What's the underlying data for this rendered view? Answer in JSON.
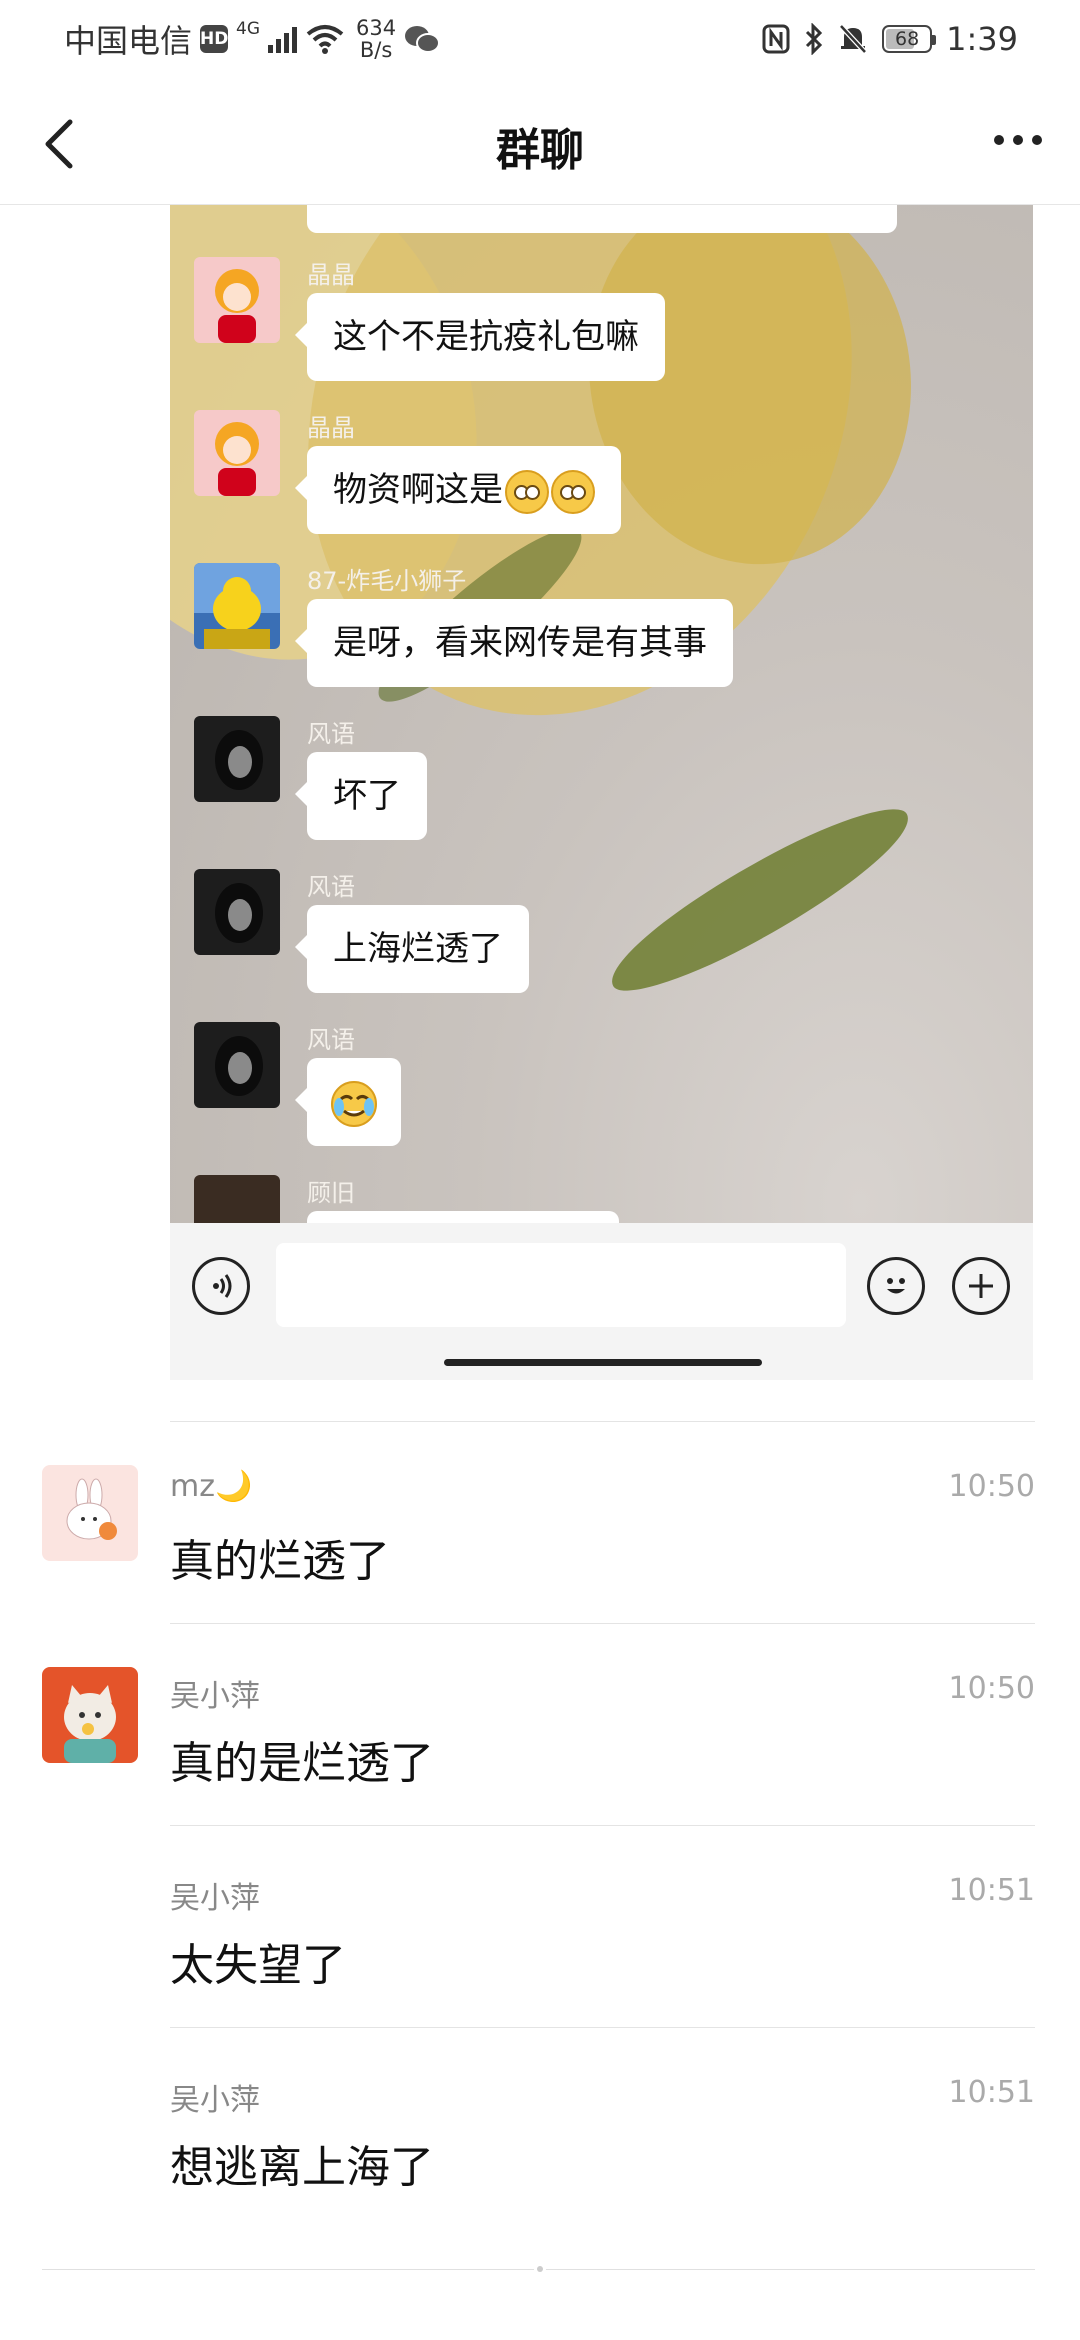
{
  "status_bar": {
    "carrier": "中国电信",
    "hd": "HD",
    "network": "4G",
    "speed_value": "634",
    "speed_unit": "B/s",
    "battery": "68",
    "time": "1:39"
  },
  "header": {
    "title": "群聊"
  },
  "embedded_chat": {
    "messages": [
      {
        "sender": "晶晶",
        "text": "这个不是抗疫礼包嘛",
        "avatar": "tiger-costume-girl"
      },
      {
        "sender": "晶晶",
        "text": "物资啊这是",
        "emoji": "flushed-face",
        "avatar": "tiger-costume-girl"
      },
      {
        "sender": "87-炸毛小狮子",
        "text": "是呀，看来网传是有其事",
        "avatar": "yellow-duck-statue"
      },
      {
        "sender": "风语",
        "text": "坏了",
        "avatar": "dark-hair-girl"
      },
      {
        "sender": "风语",
        "text": "上海烂透了",
        "avatar": "dark-hair-girl"
      },
      {
        "sender": "风语",
        "text": "",
        "emoji": "facepalm-face",
        "avatar": "dark-hair-girl"
      },
      {
        "sender": "顾旧",
        "text": "",
        "avatar": "dark-photo"
      }
    ]
  },
  "comments": [
    {
      "name": "mz🌙",
      "time": "10:50",
      "text": "真的烂透了",
      "avatar": "white-rabbit"
    },
    {
      "name": "吴小萍",
      "time": "10:50",
      "text": "真的是烂透了",
      "avatar": "cartoon-cat-orange-bg"
    },
    {
      "name": "吴小萍",
      "time": "10:51",
      "text": "太失望了"
    },
    {
      "name": "吴小萍",
      "time": "10:51",
      "text": "想逃离上海了"
    }
  ]
}
